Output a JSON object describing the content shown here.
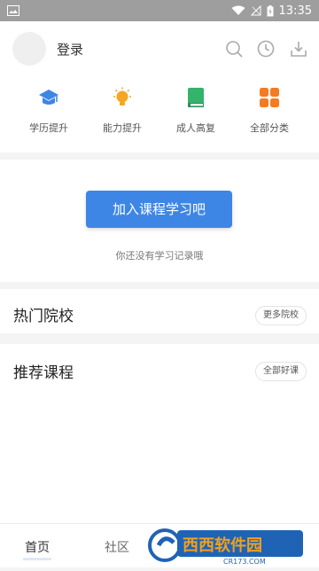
{
  "status_bar": {
    "time": "13:35",
    "icons": [
      "image-icon",
      "wifi-icon",
      "signal-icon",
      "battery-icon"
    ]
  },
  "header": {
    "login_label": "登录",
    "icons": [
      "search-icon",
      "clock-icon",
      "download-icon"
    ]
  },
  "categories": [
    {
      "label": "学历提升",
      "icon": "graduation-cap-icon",
      "color": "#3d86e6"
    },
    {
      "label": "能力提升",
      "icon": "lightbulb-icon",
      "color": "#f5a623"
    },
    {
      "label": "成人高复",
      "icon": "book-icon",
      "color": "#34b36a"
    },
    {
      "label": "全部分类",
      "icon": "grid-icon",
      "color": "#f37b22"
    }
  ],
  "empty_state": {
    "button_label": "加入课程学习吧",
    "message": "你还没有学习记录哦"
  },
  "sections": [
    {
      "title": "热门院校",
      "more_label": "更多院校"
    },
    {
      "title": "推荐课程",
      "more_label": "全部好课"
    }
  ],
  "bottom_nav": {
    "tabs": [
      {
        "label": "首页"
      },
      {
        "label": "社区"
      }
    ]
  },
  "watermark": {
    "text": "西西软件园",
    "subtext": "CR173.COM"
  },
  "colors": {
    "accent": "#3d86e6",
    "status_bar": "#9e9e9e"
  }
}
